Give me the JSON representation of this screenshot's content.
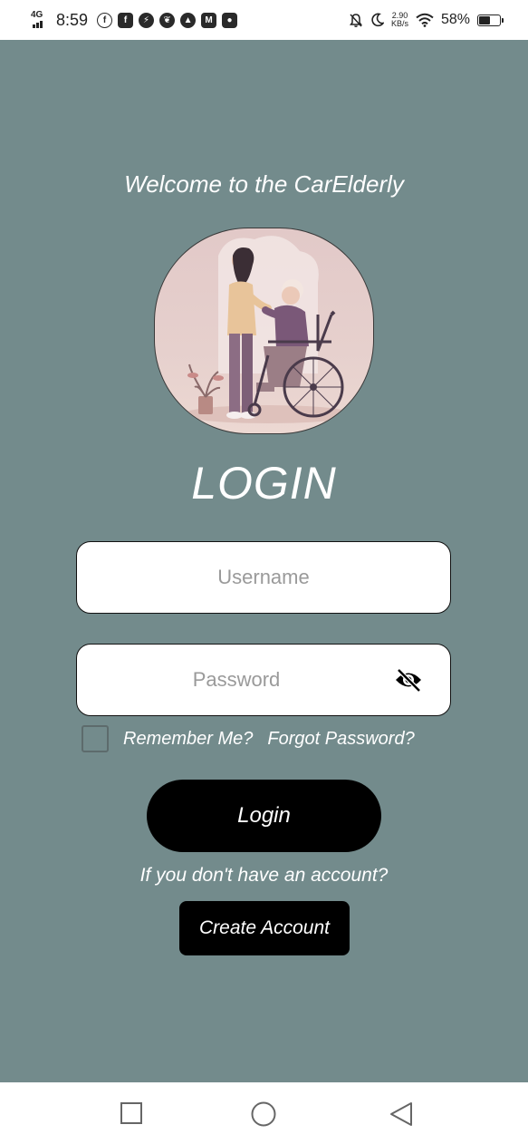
{
  "status_bar": {
    "network": "4G",
    "time": "8:59",
    "speed_value": "2.90",
    "speed_unit": "KB/s",
    "battery_percent": "58%",
    "battery_level": 0.58,
    "app_icons": [
      "facebook-icon",
      "facebook-square-icon",
      "messenger-icon",
      "leaf-app-icon",
      "arrow-app-icon",
      "gmail-icon",
      "microphone-app-icon"
    ],
    "system_icons": [
      "mute-bell-icon",
      "moon-icon",
      "wifi-icon",
      "battery-icon"
    ]
  },
  "colors": {
    "background": "#738b8c",
    "button": "#000000",
    "text": "#ffffff",
    "placeholder": "#9a9a9a"
  },
  "welcome_text": "Welcome to the CarElderly",
  "hero_image": "caregiver-with-elderly-in-wheelchair",
  "login_heading": "LOGIN",
  "username": {
    "placeholder": "Username",
    "value": ""
  },
  "password": {
    "placeholder": "Password",
    "value": "",
    "toggle_icon": "eye-slash-icon"
  },
  "remember_me": {
    "label": "Remember Me?",
    "checked": false
  },
  "forgot_password": "Forgot Password?",
  "login_button": "Login",
  "no_account_text": "If you don't have an account?",
  "create_account_button": "Create Account",
  "nav_bar": [
    "recent-apps-square-icon",
    "home-circle-icon",
    "back-triangle-icon"
  ]
}
